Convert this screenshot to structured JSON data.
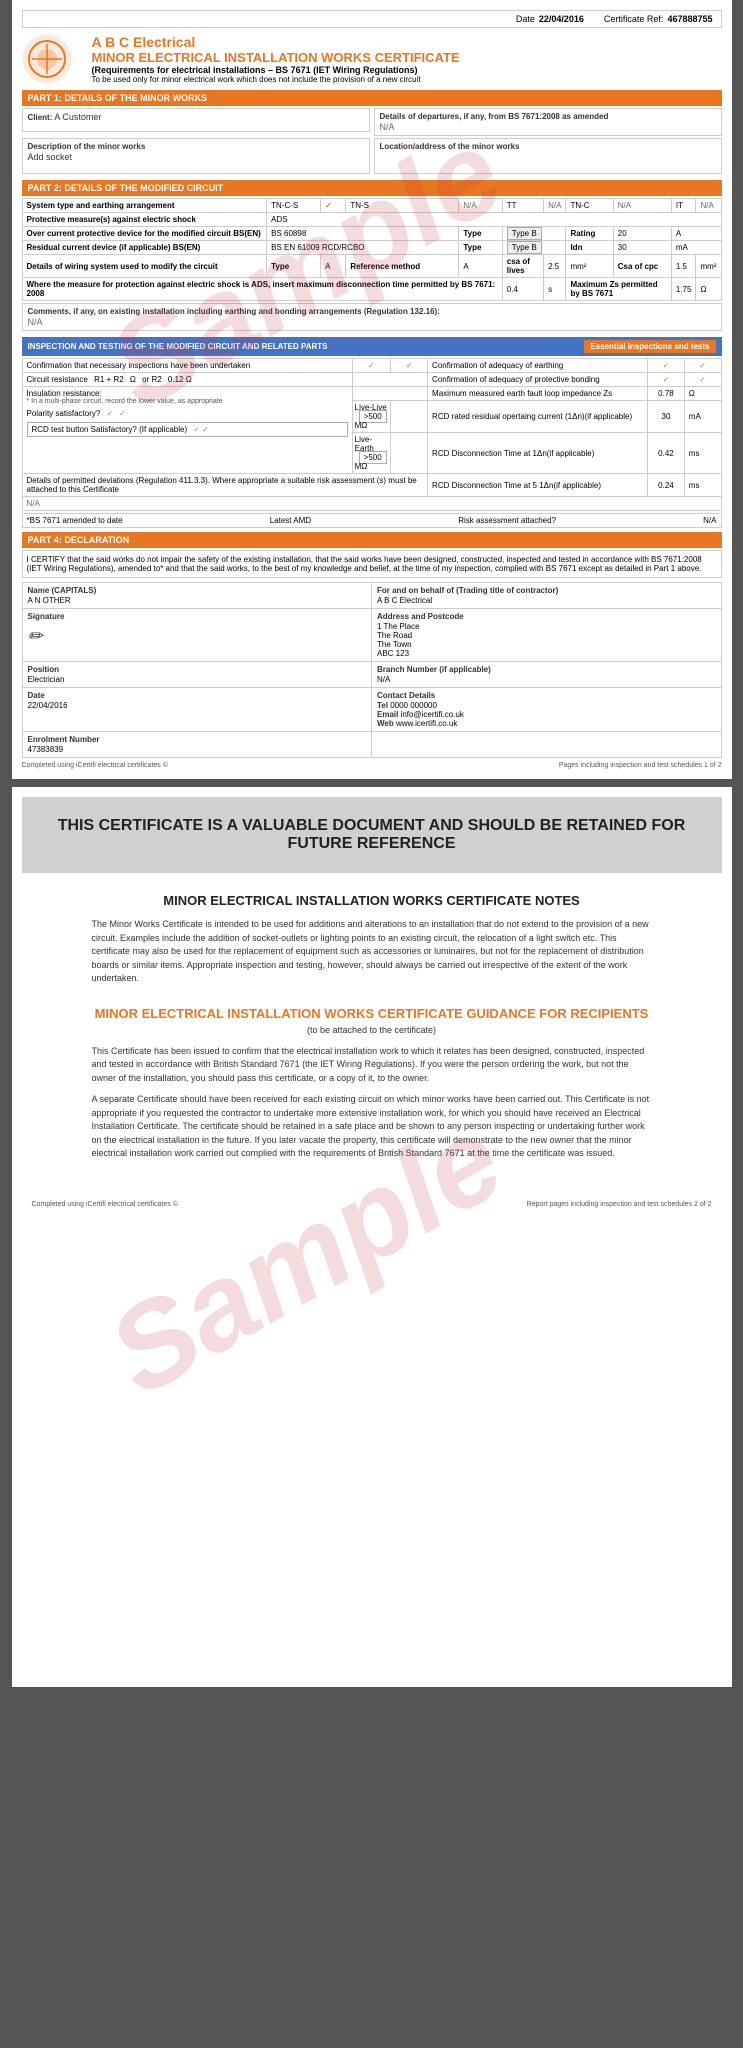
{
  "cert": {
    "date_label": "Date",
    "date_value": "22/04/2016",
    "cert_ref_label": "Certificate Ref:",
    "cert_ref_value": "467888755"
  },
  "company": {
    "name": "A B C Electrical",
    "title": "MINOR ELECTRICAL INSTALLATION WORKS CERTIFICATE",
    "subtitle": "(Requirements for electrical installations – BS 7671 (IET Wiring Regulations)",
    "subtitle2": "To be used only for minor electrical work which does not include the provision of a new circuit"
  },
  "part1": {
    "header": "PART 1: DETAILS OF THE MINOR WORKS",
    "client_label": "Client:",
    "client_value": "A Customer",
    "desc_label": "Description of the minor works",
    "desc_value": "Add socket",
    "departures_label": "Details of departures, if any, from BS 7671:2008 as amended",
    "departures_value": "N/A",
    "location_label": "Location/address of the minor works",
    "location_value": ""
  },
  "part2": {
    "header": "PART 2: DETAILS OF THE MODIFIED CIRCUIT",
    "system_label": "System type and earthing arrangement",
    "system_tncs": "TN-C-S",
    "system_tns": "TN-S",
    "system_na1": "N/A",
    "system_tt": "TT",
    "system_na2": "N/A",
    "system_tnc": "TN-C",
    "system_na3": "N/A",
    "system_it": "IT",
    "system_na4": "N/A",
    "protective_label": "Protective measure(s) against electric shock",
    "protective_value": "ADS",
    "overcurrent_label": "Over current protective device for the modified circuit BS(EN)",
    "overcurrent_bs": "BS 60898",
    "overcurrent_type_label": "Type",
    "overcurrent_type_value": "Type B",
    "overcurrent_rating_label": "Rating",
    "overcurrent_rating_value": "20",
    "overcurrent_a": "A",
    "rcd_label": "Residual current device (if applicable) BS(EN)",
    "rcd_bs": "BS EN 61009 RCD/RCBO",
    "rcd_type_label": "Type",
    "rcd_type_value": "Type B",
    "rcd_idn_label": "Idn",
    "rcd_idn_value": "30",
    "rcd_ma": "mA",
    "wiring_label": "Details of wiring system used to modify the circuit",
    "wiring_type_label": "Type",
    "wiring_type_value": "A",
    "wiring_ref_label": "Reference method",
    "wiring_ref_value": "A",
    "wiring_csa_label": "csa of lives",
    "wiring_csa_value": "2.5",
    "wiring_mm2_1": "mm²",
    "wiring_cpc_label": "Csa of cpc",
    "wiring_cpc_value": "1.5",
    "wiring_mm2_2": "mm²",
    "measure_label": "Where the measure for protection against electric shock is ADS, insert maximum disconnection time permitted by BS 7671: 2008",
    "measure_value": "0.4",
    "measure_s": "s",
    "measure_max_label": "Maximum Zs permitted by BS 7671",
    "measure_max_value": "1.75",
    "measure_ohm": "Ω",
    "comments_label": "Comments, if any, on existing installation including earthing and bonding arrangements (Regulation 132.16):",
    "comments_value": "N/A",
    "bs_amended_label": "*BS 7671 amended to date",
    "bs_amended_value": "",
    "latest_amd_label": "Latest AMD",
    "risk_label": "Risk assessment attached?",
    "risk_value": "N/A"
  },
  "part3": {
    "header": "INSPECTION AND TESTING OF THE MODIFIED CIRCUIT AND RELATED PARTS",
    "essential_label": "Essential inspections and tests",
    "confirm_insp_label": "Confirmation that necessary inspections have been undertaken",
    "confirm_earth_label": "Confirmation of adequacy of earthing",
    "circuit_res_label": "Circuit resistance",
    "r1r2_label": "R1 + R2",
    "ohm1": "Ω",
    "or_r2_label": "or R2",
    "r2_value": "0.12",
    "ohm2": "Ω",
    "confirm_bond_label": "Confirmation of adequacy of protective bonding",
    "insul_label": "Insulation resistance:",
    "insul_sub": "* In a multi-phase circuit, record the lower value, as appropriate",
    "max_earth_label": "Maximum measured earth fault loop impedance Zs",
    "max_earth_value": "0.78",
    "max_earth_ohm": "Ω",
    "polarity_label": "Polarity satisfactory?",
    "rcd_rated_label": "RCD rated residual opertaing current (1Δn)(if applicable)",
    "rcd_rated_value": "30",
    "rcd_rated_ma": "mA",
    "rcd_test_label": "RCD test button Satisfactory? (If applicable)",
    "rcd_disc1_label": "RCD Disconnection Time at 1Δn(if applicable)",
    "rcd_disc1_value": "0.42",
    "rcd_disc1_ms": "ms",
    "live_live_label": "Live-Live",
    "live_live_value": ">500",
    "live_live_mo": "MΩ",
    "rcd_disc2_label": "RCD Disconnection Time at 5 1Δn(if applicable)",
    "rcd_disc2_value": "0.24",
    "rcd_disc2_ms": "ms",
    "live_earth_label": "Live-Earth",
    "live_earth_value": ">500",
    "live_earth_mo": "MΩ",
    "deviations_label": "Details of permitted deviations (Regulation 411.3.3). Where appropriate a suitable risk assessment (s) must be attached to this Certificate",
    "deviations_value": "N/A"
  },
  "part4": {
    "header": "PART 4: DECLARATION",
    "declaration_text": "I CERTIFY that the said works do not impair the safety of the existing installation, that the said works have been designed, constructed, inspected and tested in accordance with BS 7671:2008 (IET Wiring Regulations), amended to* and that the said works, to the best of my knowledge and belief, at the time of my  inspection, complied with BS 7671 except as detailed in Part 1 above.",
    "name_label": "Name (CAPITALS)",
    "name_value": "A N OTHER",
    "behalf_label": "For and on behalf of (Trading title of contractor)",
    "behalf_value": "A B C Electrical",
    "signature_label": "Signature",
    "address_label": "Address and Postcode",
    "address_line1": "1 The Place",
    "address_line2": "The Road",
    "address_line3": "The Town",
    "address_line4": "ABC 123",
    "position_label": "Position",
    "position_value": "Electrician",
    "branch_label": "Branch Number (if applicable)",
    "branch_value": "N/A",
    "date_label": "Date",
    "date_value": "22/04/2016",
    "enrolment_label": "Enrolment Number",
    "enrolment_value": "47383839",
    "contact_label": "Contact Details",
    "tel_label": "Tel",
    "tel_value": "0000 000000",
    "email_label": "Email",
    "email_value": "info@icertifi.co.uk",
    "web_label": "Web",
    "web_value": "www.icertifi.co.uk"
  },
  "footer1": {
    "left": "Completed using iCertifi electrical certificates ©",
    "right": "Pages including inspection and test schedules 1 of 2"
  },
  "page2": {
    "retained_title": "THIS CERTIFICATE IS A VALUABLE DOCUMENT AND SHOULD BE RETAINED FOR FUTURE REFERENCE",
    "notes_title": "MINOR ELECTRICAL INSTALLATION WORKS CERTIFICATE NOTES",
    "notes_text": "The Minor Works Certificate is intended to be used for additions and alterations to an installation that do not extend to the provision of a new circuit. Examples include the addition of socket-outlets or lighting points to an existing circuit, the relocation of a light switch etc. This certificate may also be used for the replacement of equipment such as accessories or luminaires, but not for the replacement of distribution boards or similar items. Appropriate inspection and testing, however, should always be carried out irrespective of the extent of the work undertaken.",
    "guidance_title": "MINOR ELECTRICAL INSTALLATION WORKS CERTIFICATE GUIDANCE FOR RECIPIENTS",
    "guidance_subtitle": "(to be attached to the certificate)",
    "guidance_p1": "This Certificate has been issued to confirm that the electrical installation work to which it relates has been designed, constructed, inspected and tested in accordance with British Standard 7671 (the IET Wiring Regulations).  If you were the person ordering the work, but not the owner of the installation, you should pass this certificate, or a copy of it, to the owner.",
    "guidance_p2": "A separate Certificate should have been received for each existing circuit on which minor works have been carried out. This Certificate is not appropriate if you requested the contractor to undertake more extensive installation work, for which you should have received an Electrical Installation Certificate. The certificate should be retained in a safe place and be shown to any person inspecting or undertaking further work on the electrical installation in the future. If you later vacate the property, this certificate will demonstrate to the new owner that the minor electrical installation work carried out complied with the requirements of British Standard 7671 at the time the certificate was issued.",
    "footer_left": "Completed using iCertifi electrical certificates ©",
    "footer_right": "Report pages including inspection and test schedules 2 of 2"
  }
}
